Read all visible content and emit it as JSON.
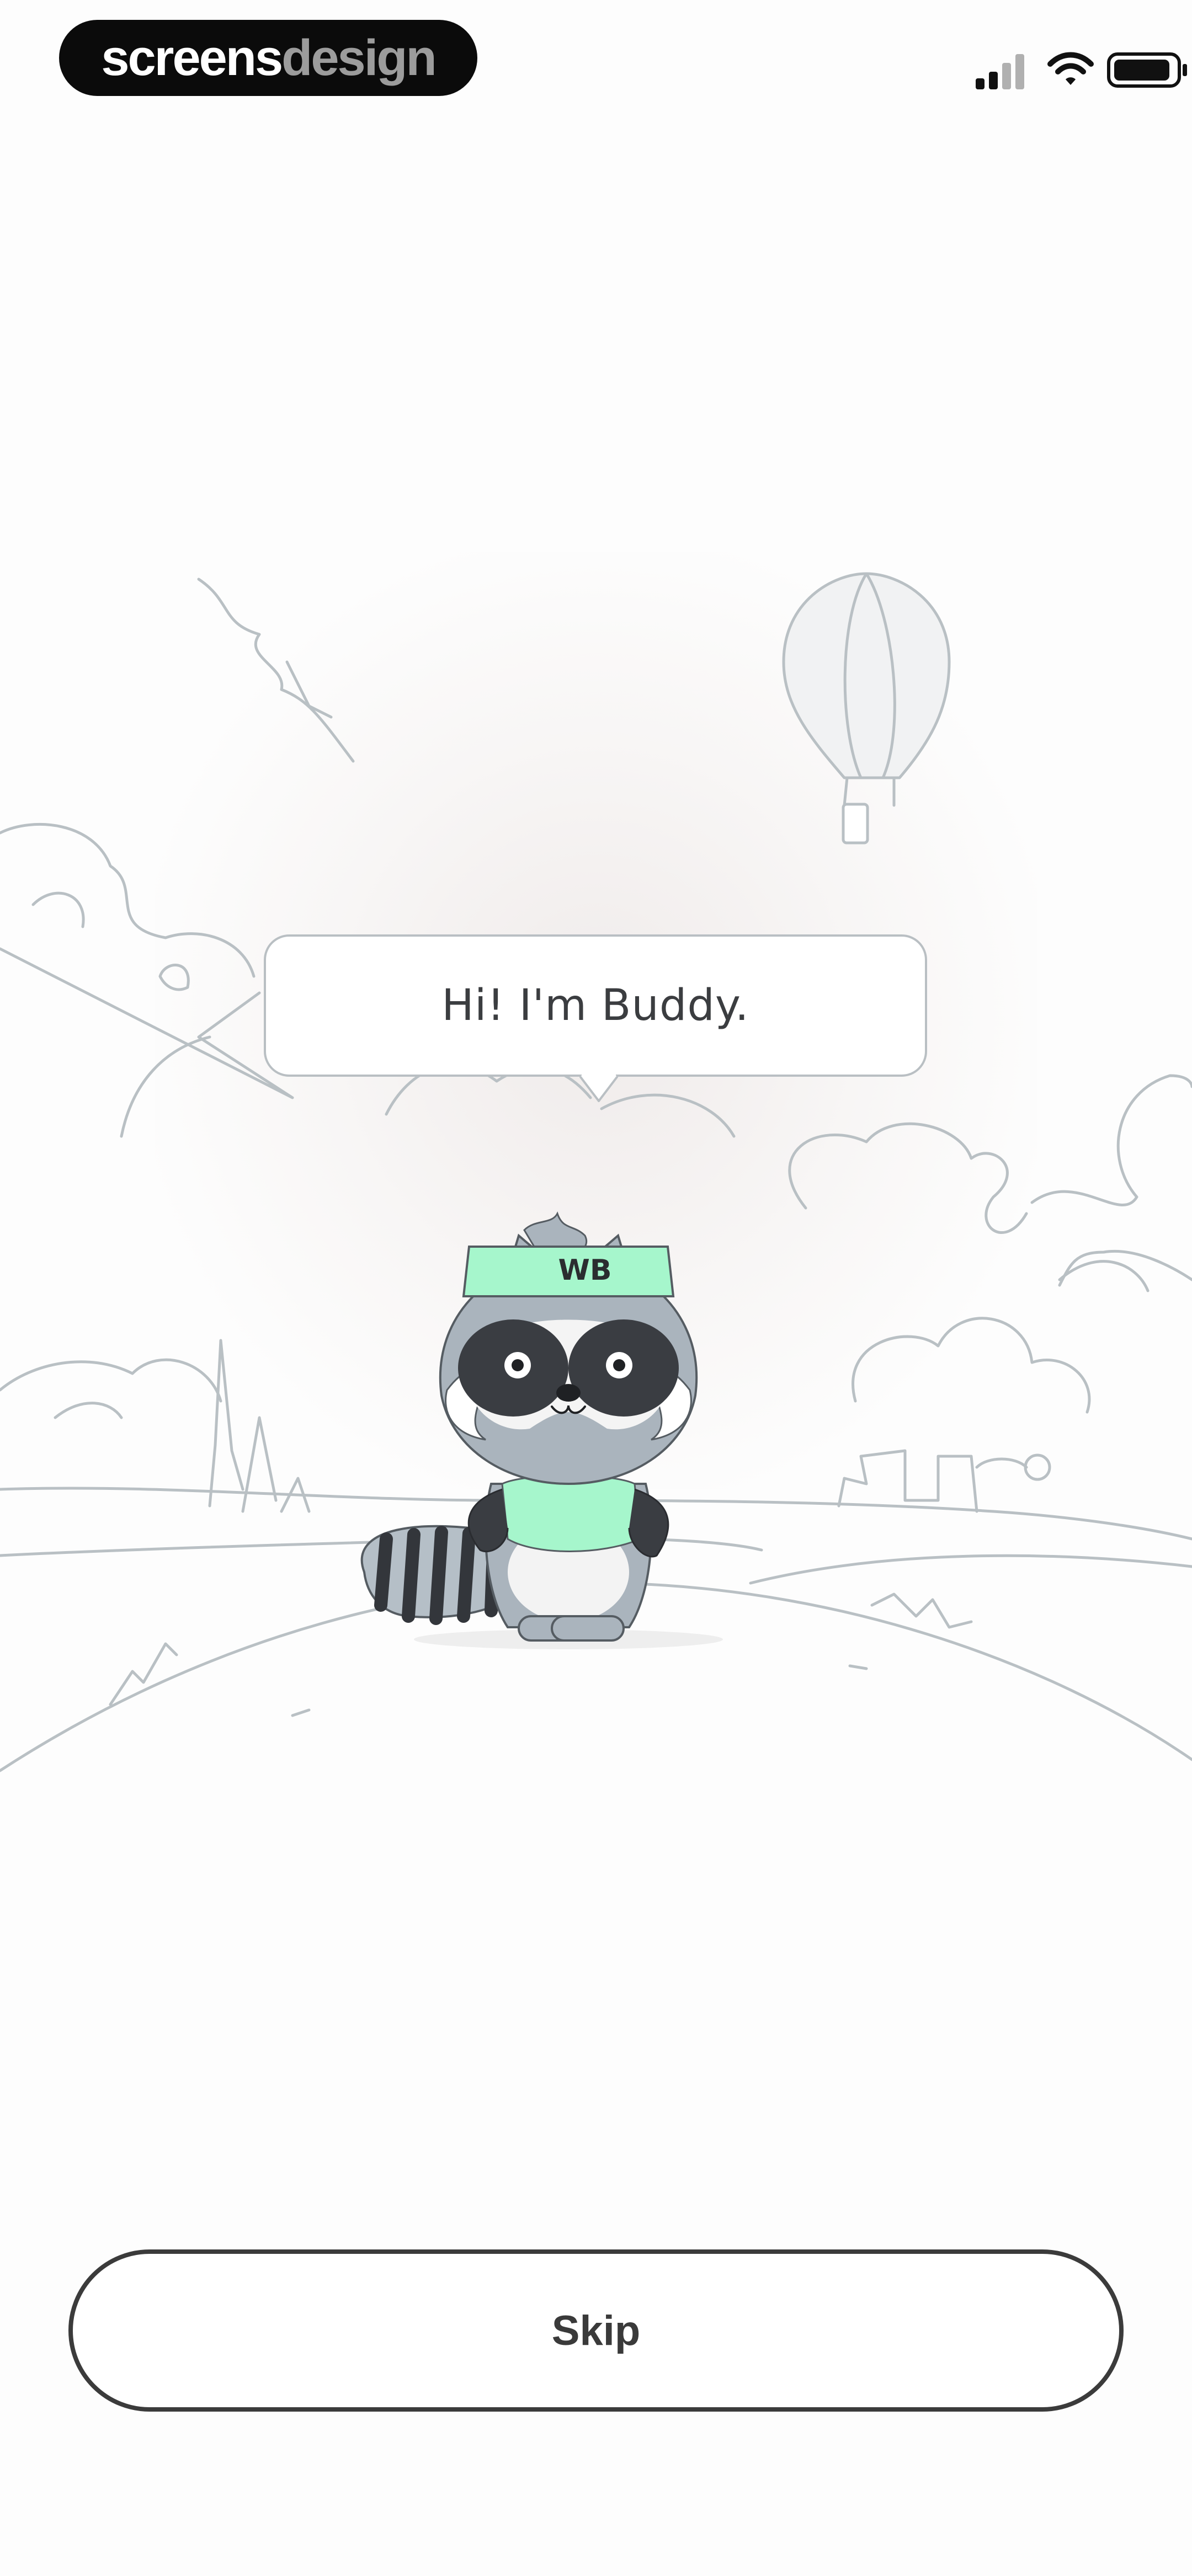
{
  "brand": {
    "part1": "screens",
    "part2": "design"
  },
  "status_bar": {
    "signal_icon": "cellular-signal-icon",
    "wifi_icon": "wifi-icon",
    "battery_icon": "battery-icon"
  },
  "mascot": {
    "headband_text": "WB",
    "speech": "Hi! I'm Buddy."
  },
  "actions": {
    "skip_label": "Skip"
  },
  "colors": {
    "accent_mint": "#a6f6cc",
    "button_border": "#3b3b3b",
    "line_art": "#b9c0c4"
  }
}
